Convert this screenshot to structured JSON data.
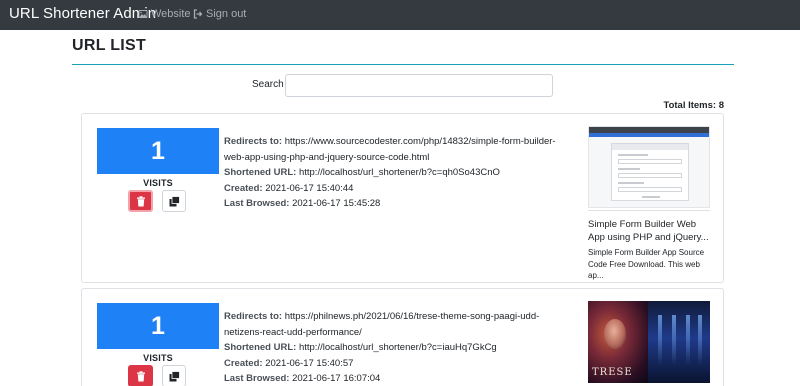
{
  "navbar": {
    "brand": "URL Shortener Admin",
    "links": [
      {
        "label": "Website",
        "icon": "image-icon"
      },
      {
        "label": "Sign out",
        "icon": "sign-out-icon"
      }
    ]
  },
  "page": {
    "title": "URL LIST",
    "search_label": "Search",
    "search_value": "",
    "search_placeholder": "",
    "total_label": "Total Items: 8"
  },
  "labels": {
    "redirects": "Redirects to:",
    "shortened": "Shortened URL:",
    "created": "Created:",
    "last_browsed": "Last Browsed:",
    "visits": "VISITS"
  },
  "colors": {
    "navbar": "#343a40",
    "count_box": "#1e82f6",
    "delete_button": "#dc3545",
    "title_rule": "#17a2b8"
  },
  "items": [
    {
      "visits": "1",
      "redirects_to": "https://www.sourcecodester.com/php/14832/simple-form-builder-web-app-using-php-and-jquery-source-code.html",
      "shortened_url": "http://localhost/url_shortener/b?c=qh0So43CnO",
      "created": "2021-06-17 15:40:44",
      "last_browsed": "2021-06-17 15:45:28",
      "preview_title": "Simple Form Builder Web App using PHP and jQuery...",
      "preview_desc": "Simple Form Builder App Source Code Free Download. This web ap..."
    },
    {
      "visits": "1",
      "redirects_to": "https://philnews.ph/2021/06/16/trese-theme-song-paagi-udd-netizens-react-udd-performance/",
      "shortened_url": "http://localhost/url_shortener/b?c=iauHq7GkCg",
      "created": "2021-06-17 15:40:57",
      "last_browsed": "2021-06-17 16:07:04",
      "preview_image_text": "TRESE"
    }
  ]
}
